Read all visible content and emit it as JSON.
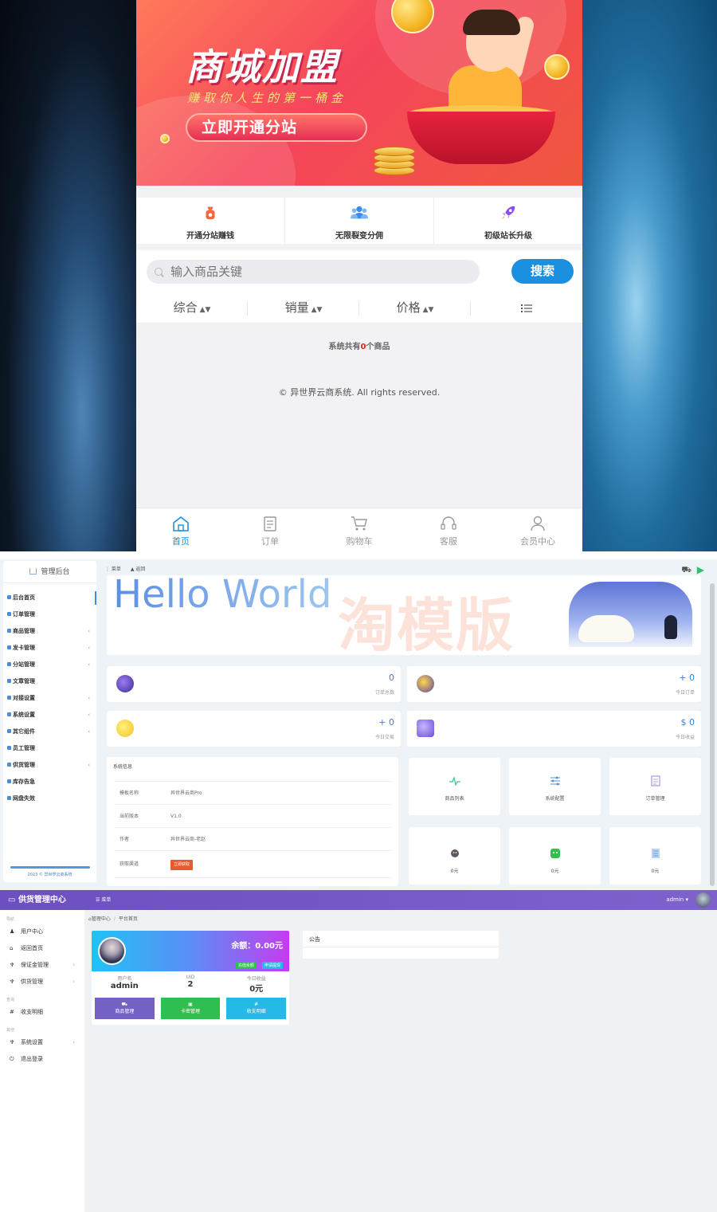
{
  "shop": {
    "banner": {
      "title": "商城加盟",
      "subtitle": "赚取你人生的第一桶金",
      "button": "立即开通分站"
    },
    "quick_links": [
      {
        "label": "开通分站赚钱",
        "icon": "money-bag-icon",
        "color": "#f06a3e"
      },
      {
        "label": "无限裂变分佣",
        "icon": "users-icon",
        "color": "#3b8ee8"
      },
      {
        "label": "初级站长升级",
        "icon": "rocket-icon",
        "color": "#8a4cf0"
      }
    ],
    "search": {
      "placeholder": "输入商品关键",
      "button": "搜索"
    },
    "sort": [
      "综合",
      "销量",
      "价格"
    ],
    "count": {
      "prefix": "系统共有",
      "value": "0",
      "suffix": "个商品"
    },
    "copyright": "© 异世界云商系统. All rights reserved.",
    "tabs": [
      {
        "label": "首页",
        "icon": "home-icon",
        "active": true
      },
      {
        "label": "订单",
        "icon": "clipboard-icon",
        "active": false
      },
      {
        "label": "购物车",
        "icon": "cart-icon",
        "active": false
      },
      {
        "label": "客服",
        "icon": "headset-icon",
        "active": false
      },
      {
        "label": "会员中心",
        "icon": "user-icon",
        "active": false
      }
    ],
    "accent": "#1b8fe0"
  },
  "admin": {
    "sidebar_title": "管理后台",
    "menu": [
      {
        "label": "后台首页",
        "has_children": false
      },
      {
        "label": "订单管理",
        "has_children": false
      },
      {
        "label": "商品管理",
        "has_children": true
      },
      {
        "label": "发卡管理",
        "has_children": true
      },
      {
        "label": "分站管理",
        "has_children": true
      },
      {
        "label": "文章管理",
        "has_children": false
      },
      {
        "label": "对接设置",
        "has_children": true
      },
      {
        "label": "系统设置",
        "has_children": true
      },
      {
        "label": "其它组件",
        "has_children": true
      },
      {
        "label": "员工管理",
        "has_children": false
      },
      {
        "label": "供货管理",
        "has_children": true
      },
      {
        "label": "库存告急",
        "has_children": false
      },
      {
        "label": "网盘失效",
        "has_children": false
      }
    ],
    "footer": "2023 © 异世界云商系统",
    "topbar": {
      "menu": "菜单",
      "back": "返回"
    },
    "hello": "Hello World",
    "watermark": "淘模版",
    "stats": [
      {
        "value": "0",
        "label": "订单总数"
      },
      {
        "value": "+ 0",
        "label": "今日订单"
      },
      {
        "value": "+ 0",
        "label": "今日交易"
      },
      {
        "value": "$ 0",
        "label": "今日收益"
      }
    ],
    "sysinfo": {
      "title": "系统信息",
      "rows": [
        {
          "key": "模板名称",
          "value": "异世界云商Pro"
        },
        {
          "key": "当前版本",
          "value": "V1.0"
        },
        {
          "key": "作者",
          "value": "异世界云商-老赵"
        },
        {
          "key": "获取渠道",
          "value": "立即获取"
        }
      ]
    },
    "shortcuts": [
      {
        "label": "商品列表",
        "icon": "pulse-icon"
      },
      {
        "label": "系统配置",
        "icon": "sliders-icon"
      },
      {
        "label": "订单管理",
        "icon": "clipboard-icon"
      },
      {
        "label": "0元",
        "icon": "alipay-icon"
      },
      {
        "label": "0元",
        "icon": "wechat-icon"
      },
      {
        "label": "0元",
        "icon": "qq-icon"
      }
    ]
  },
  "supply": {
    "brand": "供货管理中心",
    "menu_toggle": "菜单",
    "user": "admin",
    "sections": [
      {
        "caption": "导航",
        "items": [
          {
            "label": "用户中心",
            "icon": "user-icon",
            "chevron": false
          },
          {
            "label": "返回首页",
            "icon": "home-icon",
            "chevron": false
          },
          {
            "label": "保证金管理",
            "icon": "pin-icon",
            "chevron": true
          },
          {
            "label": "供货管理",
            "icon": "pin-icon",
            "chevron": true
          }
        ]
      },
      {
        "caption": "查询",
        "items": [
          {
            "label": "收支明细",
            "icon": "hash-icon",
            "chevron": false
          }
        ]
      },
      {
        "caption": "其他",
        "items": [
          {
            "label": "系统设置",
            "icon": "pin-icon",
            "chevron": true
          },
          {
            "label": "退出登录",
            "icon": "power-icon",
            "chevron": false
          }
        ]
      }
    ],
    "breadcrumb": [
      "管理中心",
      "平台首页"
    ],
    "profile": {
      "balance": "余额：0.00元",
      "tags": [
        "充值余额",
        "申请提现"
      ],
      "stats": [
        {
          "label": "用户名",
          "value": "admin"
        },
        {
          "label": "UID",
          "value": "2"
        },
        {
          "label": "今日收益",
          "value": "0元"
        }
      ],
      "buttons": [
        {
          "label": "商品管理",
          "color": "#7560c4"
        },
        {
          "label": "卡密管理",
          "color": "#2fbf4f"
        },
        {
          "label": "收支明细",
          "color": "#25b9e6"
        }
      ]
    },
    "notice": "公告"
  }
}
